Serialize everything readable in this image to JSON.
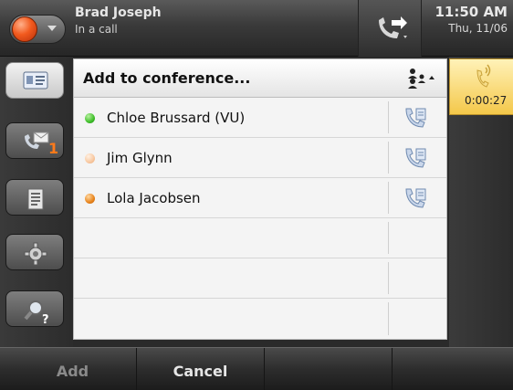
{
  "status_bar": {
    "user_name": "Brad Joseph",
    "user_status": "In a call",
    "time": "11:50 AM",
    "date": "Thu, 11/06",
    "presence_color": "#f25a1e"
  },
  "nav": {
    "items": [
      {
        "icon": "contacts-card-icon",
        "active": true
      },
      {
        "icon": "voicemail-icon",
        "badge": "1"
      },
      {
        "icon": "call-history-icon"
      },
      {
        "icon": "settings-gear-icon"
      },
      {
        "icon": "search-help-icon"
      }
    ]
  },
  "dialog": {
    "title": "Add to conference...",
    "contacts": [
      {
        "name": "Chloe Brussard (VU)",
        "presence": "available",
        "color": "#3fbf2a"
      },
      {
        "name": "Jim Glynn",
        "presence": "away",
        "color": "#f8c8a0"
      },
      {
        "name": "Lola Jacobsen",
        "presence": "busy",
        "color": "#e8841c"
      }
    ]
  },
  "active_call": {
    "timer": "0:00:27"
  },
  "softkeys": {
    "add_label": "Add",
    "cancel_label": "Cancel"
  }
}
